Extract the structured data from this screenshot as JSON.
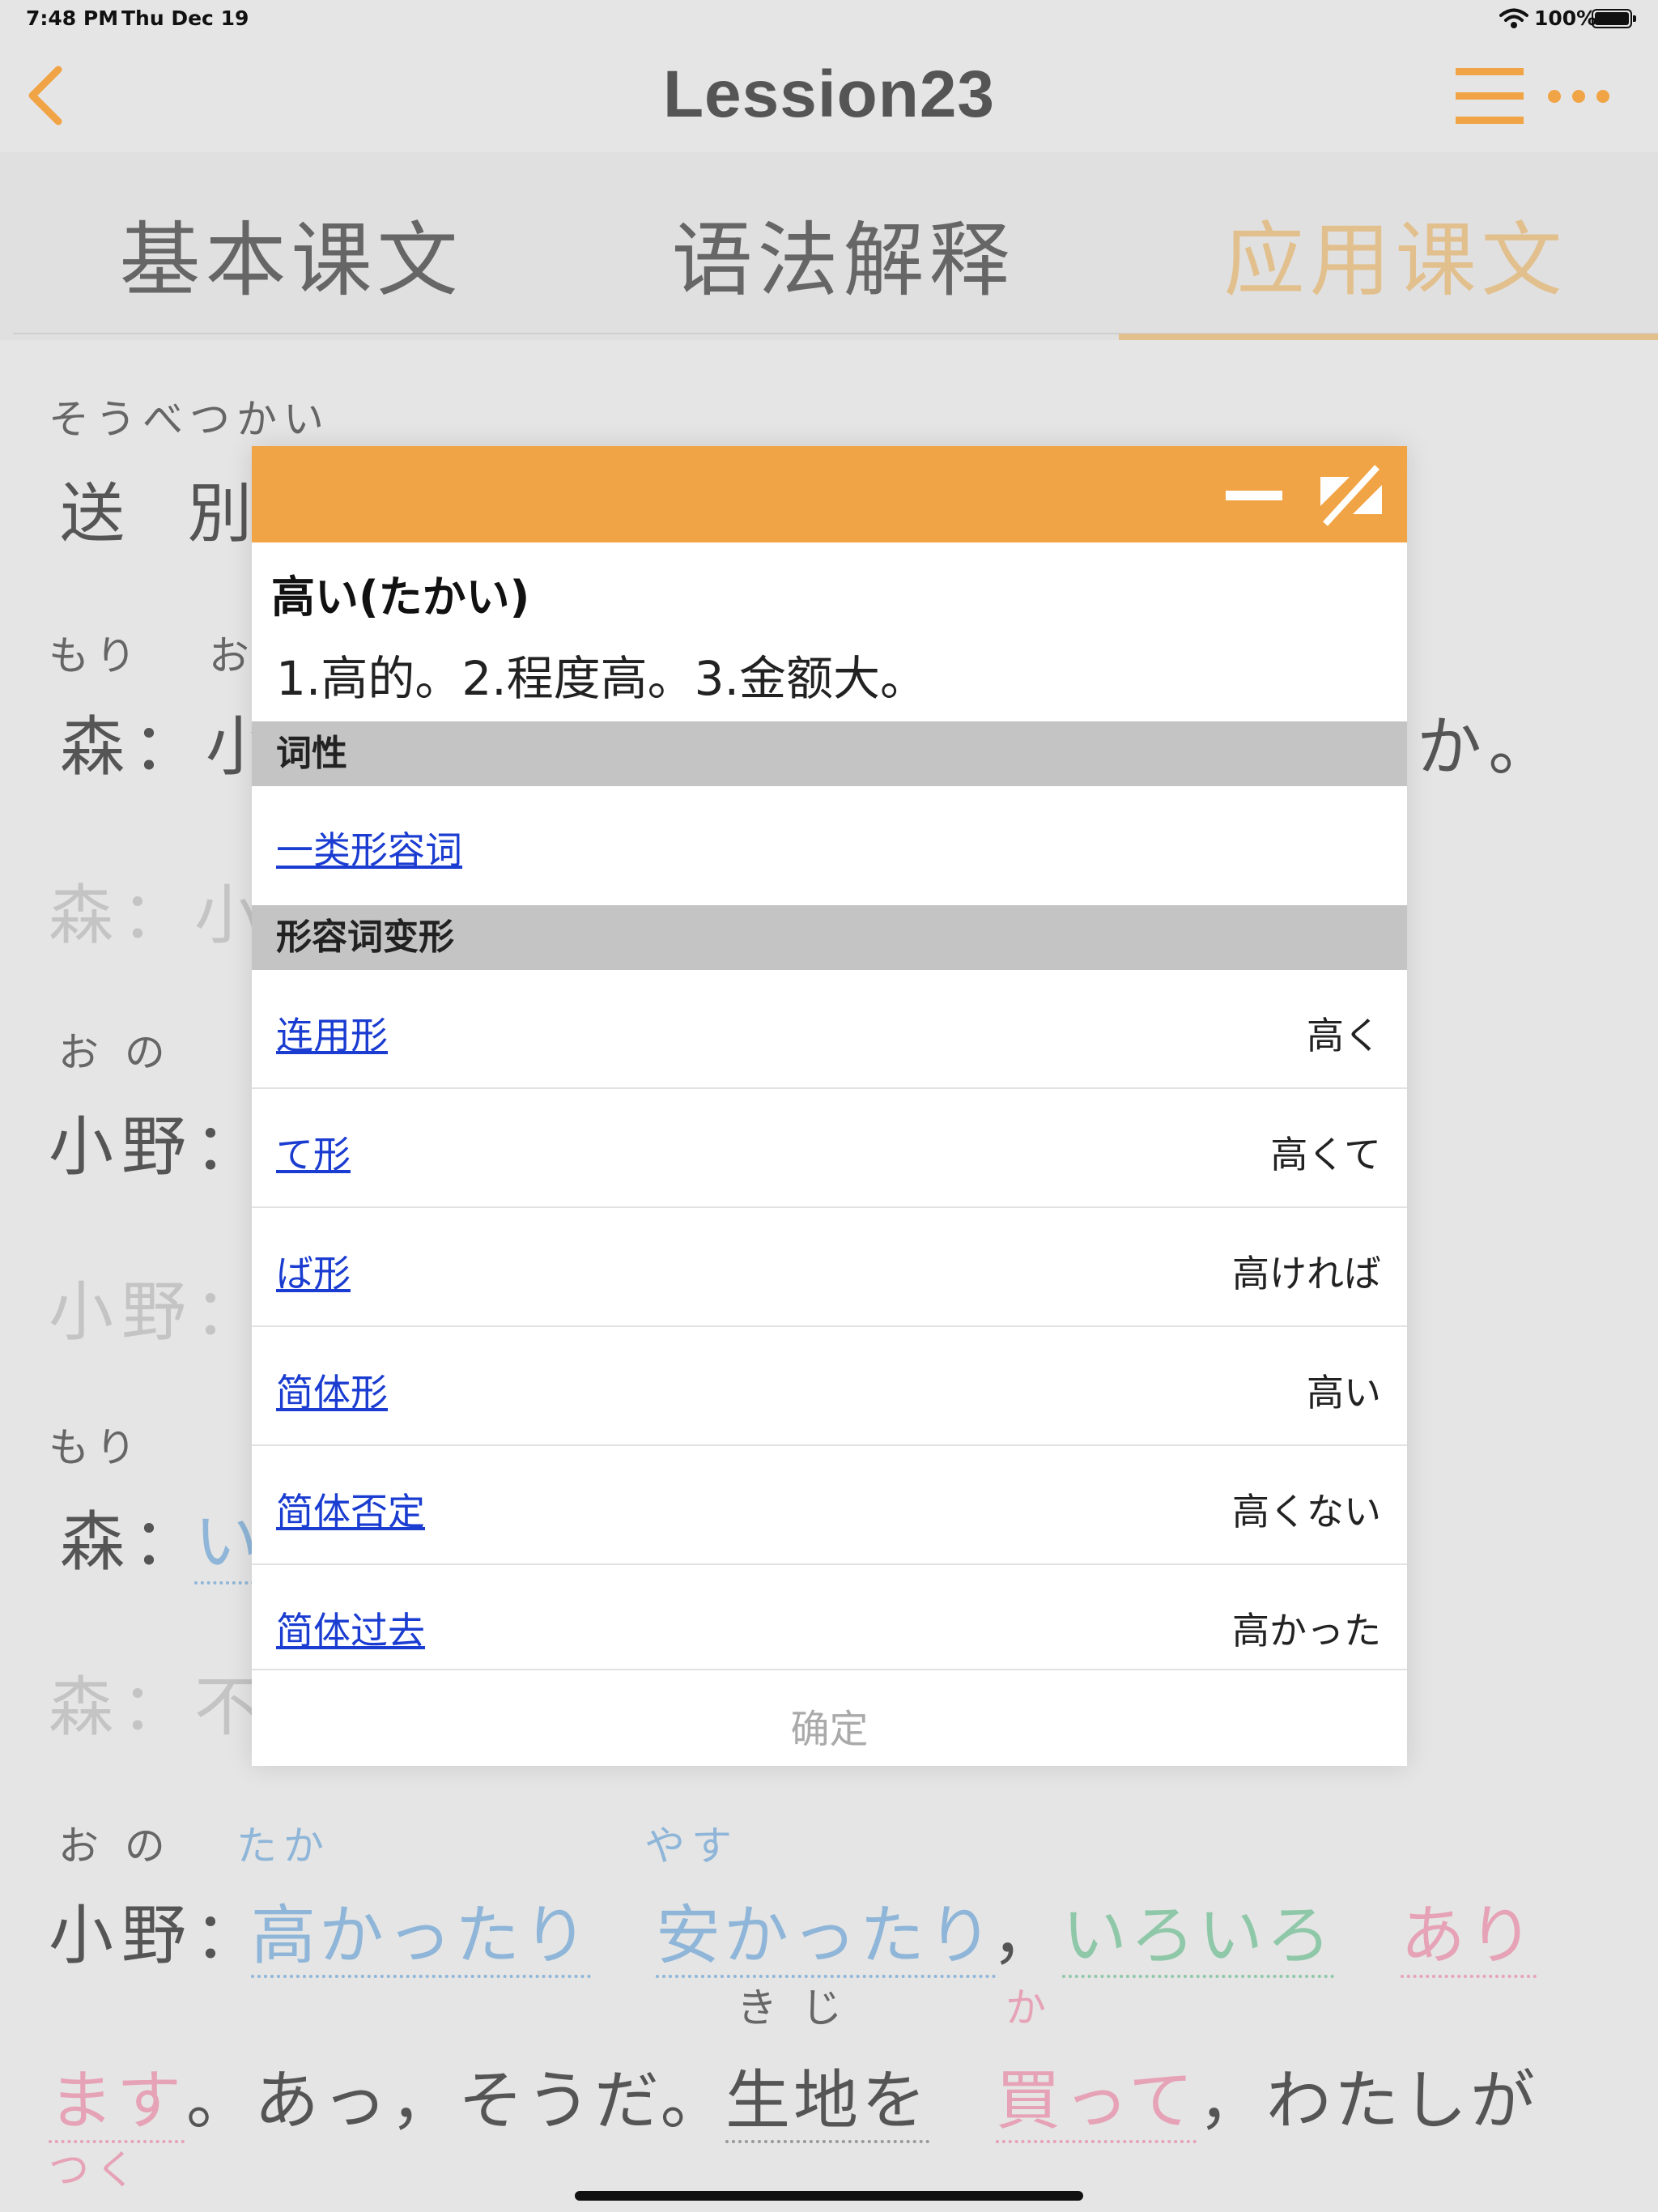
{
  "status_bar": {
    "time": "7:48 PM",
    "date": "Thu Dec 19",
    "battery_pct": "100%"
  },
  "nav": {
    "title": "Lession23",
    "icons": [
      "chevron-left-icon",
      "hamburger-menu-icon",
      "more-dots-icon"
    ]
  },
  "tabs": [
    {
      "label": "基本课文",
      "active": false
    },
    {
      "label": "语法解释",
      "active": false
    },
    {
      "label": "应用课文",
      "active": true
    }
  ],
  "colors": {
    "accent": "#f0a445",
    "tab_active": "#e2c08e",
    "link": "#1a3cd1",
    "section_bg": "#c4c4c4",
    "background": "#e5e5e5"
  },
  "lesson": {
    "title_ruby": "そうべつかい",
    "title": "送 別",
    "b1_ruby": "もり　 お",
    "b1_line": "森：小",
    "b1_tail": "か。",
    "b1_trans": "森：小",
    "b2_ruby": "お の",
    "b2_line": "小野：",
    "b2_trans": "小野：",
    "b3_ruby": "もり",
    "b3_line": "森：",
    "b3_word": "い",
    "b3_trans": "森：不",
    "b4_ruby_speaker": "お の",
    "b4_ruby_1": "たか",
    "b4_ruby_2": "やす",
    "b4_speaker": "小野：",
    "b4_w1": "高かったり",
    "b4_w2": "安かったり",
    "b4_comma": "，",
    "b4_w3": "いろいろ",
    "b4_w4": "あり",
    "b5_ruby_1": "きじ",
    "b5_ruby_2": "か",
    "b5_w1": "ます",
    "b5_t1": "。あっ，そうだ。",
    "b5_w2": "生地を",
    "b5_w3": "買って",
    "b5_t2": "，わたしが",
    "b6_ruby": "つく"
  },
  "popup": {
    "word": "高い(たかい)",
    "meaning": "1.高的。2.程度高。3.金额大。",
    "section_pos": "词性",
    "pos_link": "一类形容词",
    "section_conj": "形容词变形",
    "conjugations": [
      {
        "label": "连用形",
        "value": "高く"
      },
      {
        "label": "て形",
        "value": "高くて"
      },
      {
        "label": "ば形",
        "value": "高ければ"
      },
      {
        "label": "简体形",
        "value": "高い"
      },
      {
        "label": "简体否定",
        "value": "高くない"
      },
      {
        "label": "简体过去",
        "value": "高かった"
      }
    ],
    "confirm": "确定"
  }
}
